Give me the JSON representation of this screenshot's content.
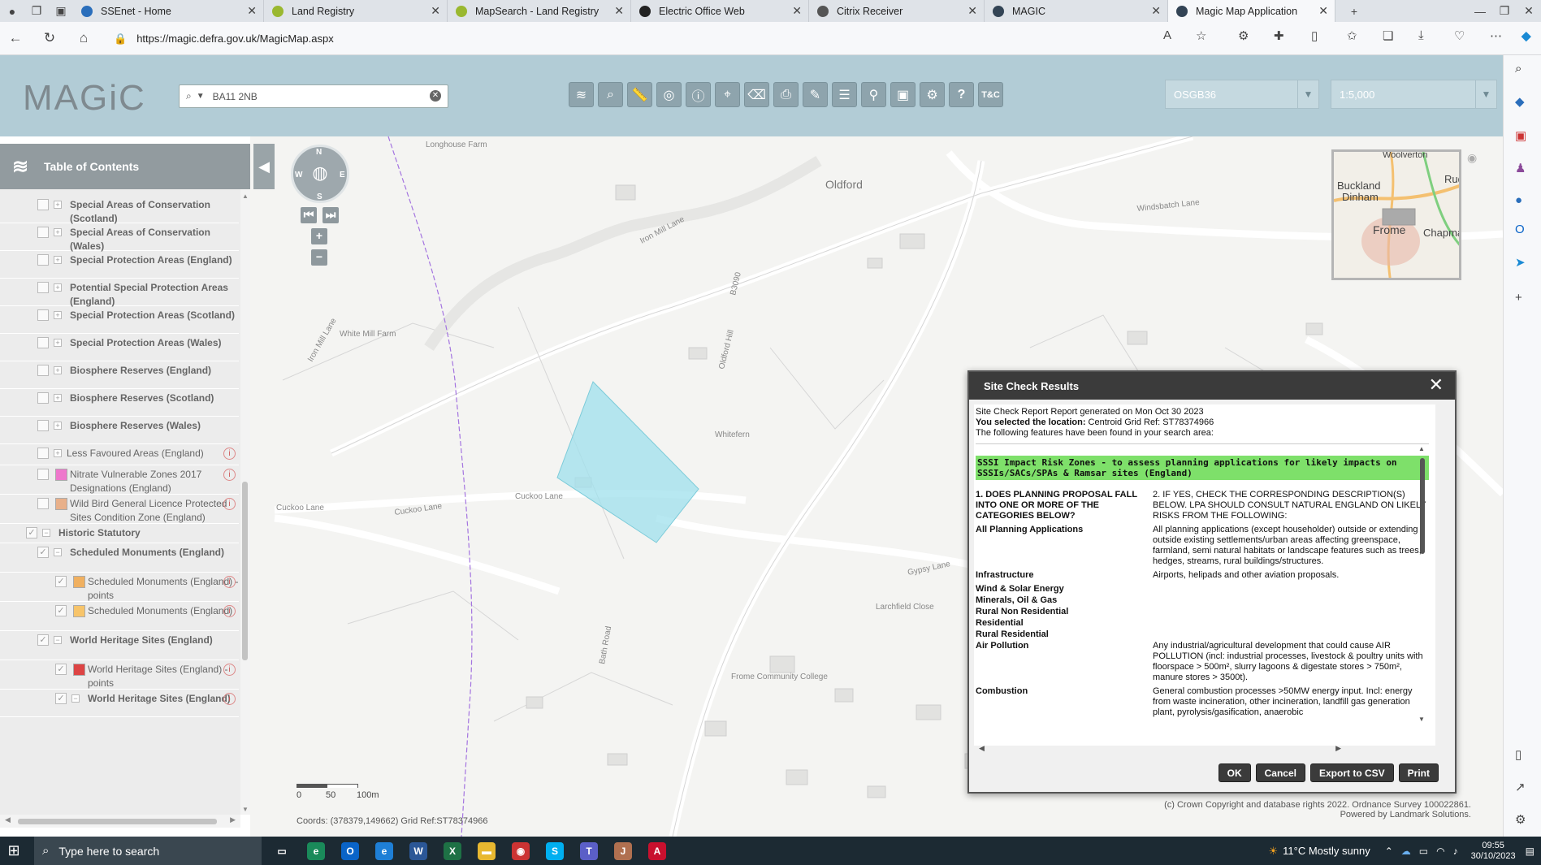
{
  "browser": {
    "tabs": [
      {
        "title": "SSEnet - Home",
        "favicon_color": "#2a6ebb"
      },
      {
        "title": "Land Registry",
        "favicon_color": "#9ab82f"
      },
      {
        "title": "MapSearch - Land Registry",
        "favicon_color": "#9ab82f"
      },
      {
        "title": "Electric Office Web",
        "favicon_color": "#222222"
      },
      {
        "title": "Citrix Receiver",
        "favicon_color": "#555555"
      },
      {
        "title": "MAGIC",
        "favicon_color": "#334455"
      },
      {
        "title": "Magic Map Application",
        "favicon_color": "#334455"
      }
    ],
    "url": "https://magic.defra.gov.uk/MagicMap.aspx"
  },
  "app": {
    "logo": "MAGiC",
    "search": {
      "value": "BA11 2NB"
    },
    "projection": "OSGB36",
    "scale": "1:5,000",
    "tools": [
      "layers-icon",
      "zoom-icon",
      "measure-icon",
      "locate-icon",
      "info-icon",
      "search-area-icon",
      "eraser-icon",
      "print-icon",
      "draw-icon",
      "list-icon",
      "find-icon",
      "bookmark-icon",
      "settings-icon",
      "help-icon",
      "terms-icon"
    ],
    "tool_labels": {
      "help": "?",
      "terms": "T&C"
    }
  },
  "toc": {
    "title": "Table of Contents",
    "items": [
      {
        "label": "Special Areas of Conservation (Scotland)",
        "type": "layer"
      },
      {
        "label": "Special Areas of Conservation (Wales)",
        "type": "layer"
      },
      {
        "label": "Special Protection Areas (England)",
        "type": "layer"
      },
      {
        "label": "Potential Special Protection Areas (England)",
        "type": "layer"
      },
      {
        "label": "Special Protection Areas (Scotland)",
        "type": "layer"
      },
      {
        "label": "Special Protection Areas (Wales)",
        "type": "layer"
      },
      {
        "label": "Biosphere Reserves (England)",
        "type": "layer"
      },
      {
        "label": "Biosphere Reserves (Scotland)",
        "type": "layer"
      },
      {
        "label": "Biosphere Reserves (Wales)",
        "type": "layer"
      },
      {
        "label": "Less Favoured Areas (England)",
        "type": "plain"
      },
      {
        "label": "Nitrate Vulnerable Zones 2017 Designations (England)",
        "type": "swatch",
        "color": "#ee77cc"
      },
      {
        "label": "Wild Bird General Licence Protected Sites Condition Zone (England)",
        "type": "swatch",
        "color": "#e8b08a"
      },
      {
        "label": "Historic Statutory",
        "type": "group"
      },
      {
        "label": "Scheduled Monuments (England)",
        "type": "layer"
      },
      {
        "label": "Scheduled Monuments (England) - points",
        "type": "swatch",
        "color": "#f0b060"
      },
      {
        "label": "Scheduled Monuments (England)",
        "type": "swatch",
        "color": "#f7c46a"
      },
      {
        "label": "World Heritage Sites (England)",
        "type": "layer"
      },
      {
        "label": "World Heritage Sites (England) - points",
        "type": "swatch",
        "color": "#d44"
      },
      {
        "label": "World Heritage Sites (England)",
        "type": "layer"
      }
    ]
  },
  "map": {
    "labels": {
      "longhouse": "Longhouse Farm",
      "oldford": "Oldford",
      "ironmill": "Iron Mill Lane",
      "windsbatch": "Windsbatch Lane",
      "whitemill": "White Mill Farm",
      "ironmill2": "Iron Mill Lane",
      "b3090": "B3090",
      "oldfordhill": "Oldford Hill",
      "whitefern": "Whitefern",
      "cuckoo1": "Cuckoo Lane",
      "cuckoo2": "Cuckoo Lane",
      "cuckoo3": "Cuckoo Lane",
      "gypsy": "Gypsy Lane",
      "larchfield": "Larchfield Close",
      "bath": "Bath Road",
      "frome_college": "Frome Community College"
    },
    "scalebar": {
      "ticks": [
        "0",
        "50",
        "100m"
      ]
    },
    "coords": "Coords: (378379,149662) Grid Ref:ST78374966",
    "copyright_lines": [
      "(c) Crown Copyright and database rights 2022. Ordnance Survey 100022861.",
      "Powered by Landmark Solutions."
    ],
    "overview_labels": {
      "woolverton": "Woolverton",
      "buckland": "Buckland",
      "dinham": "Dinham",
      "frome": "Frome",
      "rudge": "Rudge",
      "chapman": "Chapman"
    },
    "compass": {
      "n": "N",
      "e": "E",
      "s": "S",
      "w": "W"
    },
    "polygon_color": "#9fe0ec"
  },
  "dialog": {
    "title": "Site Check Results",
    "intro1": "Site Check Report Report generated on Mon Oct 30 2023",
    "intro2_bold": "You selected the location:",
    "intro2_rest": " Centroid Grid Ref: ST78374966",
    "intro3": "The following features have been found in your search area:",
    "heading": "SSSI Impact Risk Zones - to assess planning applications for likely impacts on SSSIs/SACs/SPAs & Ramsar sites (England)",
    "rows": [
      {
        "c1": "1. DOES PLANNING PROPOSAL FALL INTO ONE OR MORE OF THE CATEGORIES BELOW?",
        "c2": "2. IF YES, CHECK THE CORRESPONDING DESCRIPTION(S) BELOW. LPA SHOULD CONSULT NATURAL ENGLAND ON LIKELY RISKS FROM THE FOLLOWING:"
      },
      {
        "c1": "All Planning Applications",
        "c2": "All planning applications (except householder) outside or extending outside existing settlements/urban areas affecting greenspace, farmland, semi natural habitats or landscape features such as trees, hedges, streams, rural buildings/structures."
      },
      {
        "c1": "Infrastructure",
        "c2": "Airports, helipads and other aviation proposals."
      },
      {
        "c1": "Wind & Solar Energy",
        "c2": ""
      },
      {
        "c1": "Minerals, Oil & Gas",
        "c2": ""
      },
      {
        "c1": "Rural Non Residential",
        "c2": ""
      },
      {
        "c1": "Residential",
        "c2": ""
      },
      {
        "c1": "Rural Residential",
        "c2": ""
      },
      {
        "c1": "Air Pollution",
        "c2": "Any industrial/agricultural development that could cause AIR POLLUTION (incl: industrial processes, livestock & poultry units with floorspace > 500m², slurry lagoons & digestate stores > 750m², manure stores > 3500t)."
      },
      {
        "c1": "Combustion",
        "c2": "General combustion processes >50MW energy input. Incl: energy from waste incineration, other incineration, landfill gas generation plant, pyrolysis/gasification, anaerobic"
      }
    ],
    "buttons": {
      "ok": "OK",
      "cancel": "Cancel",
      "export": "Export to CSV",
      "print": "Print"
    }
  },
  "taskbar": {
    "search_placeholder": "Type here to search",
    "apps": [
      {
        "name": "task-view",
        "color": "#1c2a33",
        "glyph": "▭"
      },
      {
        "name": "edge",
        "color": "#1a8a5a",
        "glyph": "e"
      },
      {
        "name": "outlook",
        "color": "#0a64c8",
        "glyph": "O"
      },
      {
        "name": "ie",
        "color": "#1e7fd6",
        "glyph": "e"
      },
      {
        "name": "word",
        "color": "#2b5797",
        "glyph": "W"
      },
      {
        "name": "excel",
        "color": "#1e7145",
        "glyph": "X"
      },
      {
        "name": "explorer",
        "color": "#e8b830",
        "glyph": "▬"
      },
      {
        "name": "app-8",
        "color": "#c33",
        "glyph": "◉"
      },
      {
        "name": "skype",
        "color": "#00aff0",
        "glyph": "S"
      },
      {
        "name": "teams",
        "color": "#5b5fc7",
        "glyph": "T"
      },
      {
        "name": "java",
        "color": "#b07050",
        "glyph": "J"
      },
      {
        "name": "acrobat",
        "color": "#c8102e",
        "glyph": "A"
      }
    ],
    "weather": "11°C  Mostly sunny",
    "time": "09:55",
    "date": "30/10/2023"
  }
}
